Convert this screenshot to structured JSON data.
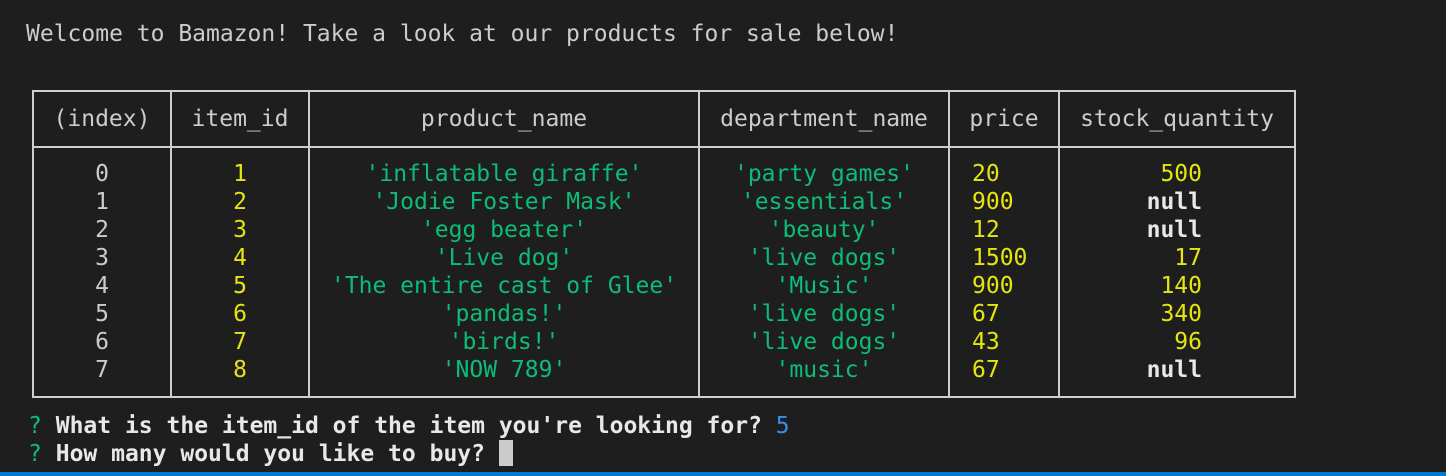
{
  "welcome": "Welcome to Bamazon! Take a look at our products for sale below!",
  "table": {
    "headers": [
      "(index)",
      "item_id",
      "product_name",
      "department_name",
      "price",
      "stock_quantity"
    ],
    "rows": [
      {
        "index": "0",
        "item_id": "1",
        "product_name": "'inflatable giraffe'",
        "department_name": "'party games'",
        "price": "20",
        "stock": "500"
      },
      {
        "index": "1",
        "item_id": "2",
        "product_name": "'Jodie Foster Mask'",
        "department_name": "'essentials'",
        "price": "900",
        "stock": "null"
      },
      {
        "index": "2",
        "item_id": "3",
        "product_name": "'egg beater'",
        "department_name": "'beauty'",
        "price": "12",
        "stock": "null"
      },
      {
        "index": "3",
        "item_id": "4",
        "product_name": "'Live dog'",
        "department_name": "'live dogs'",
        "price": "1500",
        "stock": "17"
      },
      {
        "index": "4",
        "item_id": "5",
        "product_name": "'The entire cast of Glee'",
        "department_name": "'Music'",
        "price": "900",
        "stock": "140"
      },
      {
        "index": "5",
        "item_id": "6",
        "product_name": "'pandas!'",
        "department_name": "'live dogs'",
        "price": "67",
        "stock": "340"
      },
      {
        "index": "6",
        "item_id": "7",
        "product_name": "'birds!'",
        "department_name": "'live dogs'",
        "price": "43",
        "stock": "96"
      },
      {
        "index": "7",
        "item_id": "8",
        "product_name": "'NOW 789'",
        "department_name": "'music'",
        "price": "67",
        "stock": "null"
      }
    ]
  },
  "prompts": [
    {
      "marker": "?",
      "question": "What is the item_id of the item you're looking for?",
      "answer": "5"
    },
    {
      "marker": "?",
      "question": "How many would you like to buy?",
      "answer": ""
    }
  ],
  "colors": {
    "background": "#1e1e1e",
    "number": "#e5e510",
    "string": "#0dbc79",
    "answer": "#3b8eea",
    "status_strip": "#007acc"
  }
}
